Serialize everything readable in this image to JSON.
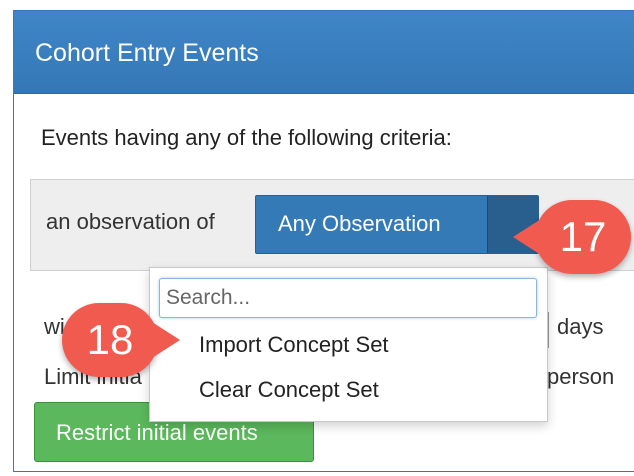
{
  "panel": {
    "title": "Cohort Entry Events"
  },
  "criteria": {
    "intro": "Events having any of the following criteria:",
    "row": {
      "prefix": "an observation of",
      "concept_button_label": "Any Observation"
    }
  },
  "background_fragments": {
    "with_fragment": "wi",
    "days": "days",
    "limit_fragment": "Limit initia",
    "person_fragment": "person"
  },
  "restrict_button_label": "Restrict initial events",
  "dropdown": {
    "search_placeholder": "Search...",
    "items": [
      "Import Concept Set",
      "Clear Concept Set"
    ]
  },
  "callouts": {
    "first": "17",
    "second": "18"
  },
  "colors": {
    "header": "#3577b6",
    "concept_button": "#337ab7",
    "restrict_button": "#5cb85c",
    "callout": "#f15b4f"
  }
}
